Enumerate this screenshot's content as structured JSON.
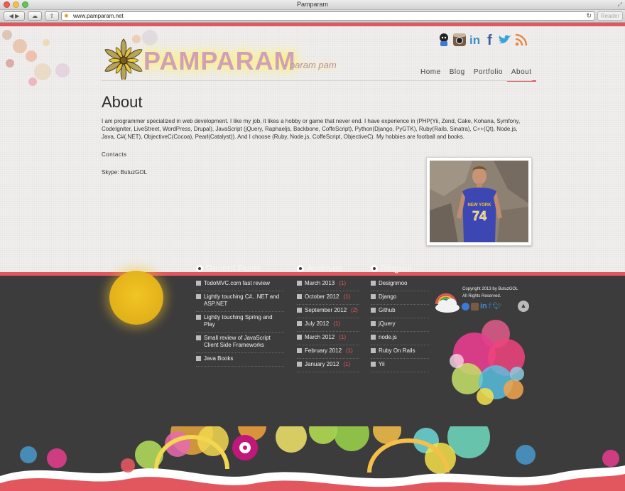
{
  "window": {
    "title": "Pamparam"
  },
  "browser": {
    "url": "www.pamparam.net",
    "reader_label": "Reader"
  },
  "header": {
    "logo_text": "PAMPARAM",
    "logo_tagline": "- param pam",
    "social_icons": [
      "github-icon",
      "instagram-icon",
      "linkedin-icon",
      "facebook-icon",
      "twitter-icon",
      "rss-icon"
    ],
    "nav": [
      {
        "label": "Home",
        "active": false
      },
      {
        "label": "Blog",
        "active": false
      },
      {
        "label": "Portfolio",
        "active": false
      },
      {
        "label": "About",
        "active": true
      }
    ]
  },
  "main": {
    "title": "About",
    "intro": "I am programmer specialized in web development. I like my job, it likes a hobby or game that never end. I have experience in (PHP(Yii, Zend, Cake, Kohana, Symfony, CodeIgniter, LiveStreet, WordPress, Drupal), JavaScript (jQuery, Raphaeljs, Backbone, CoffeScript), Python(Django, PyGTK), Ruby(Rails, Sinatra), C++(Qt), Node.js, Java, C#(.NET), ObjectiveC(Cocoa), Pearl(Catalyst)). And I choose (Ruby, Node.js, CoffeScript, ObjectiveC). My hobbies are football and books.",
    "contacts_label": "Contacts",
    "skype": "Skype: ButuzGOL",
    "jersey_text": "NEW YORK 74"
  },
  "footer": {
    "recent_posts": {
      "title": "Recent Posts",
      "items": [
        "TodoMVC.com fast review",
        "Lightly touching C#, .NET and ASP.NET",
        "Lightly touching Spring and Play",
        "Small review of JavaScript Client Side Frameworks",
        "Java Books"
      ]
    },
    "archives": {
      "title": "Archives",
      "items": [
        {
          "label": "March 2013",
          "count": "(1)"
        },
        {
          "label": "October 2012",
          "count": "(1)"
        },
        {
          "label": "September 2012",
          "count": "(2)"
        },
        {
          "label": "July 2012",
          "count": "(1)"
        },
        {
          "label": "March 2012",
          "count": "(1)"
        },
        {
          "label": "February 2012",
          "count": "(1)"
        },
        {
          "label": "January 2012",
          "count": "(1)"
        }
      ]
    },
    "blogroll": {
      "title": "Blogroll",
      "items": [
        "Designmoo",
        "Django",
        "Github",
        "jQuery",
        "node.js",
        "Ruby On Rails",
        "Yii"
      ]
    },
    "copyright_line1": "Copyright 2013 by ButuzGOL",
    "copyright_line2": "All Rights Reserved."
  },
  "colors": {
    "accent": "#e2575e",
    "footer_bg": "#3d3c3c",
    "hero_bg": "#f1efed"
  }
}
